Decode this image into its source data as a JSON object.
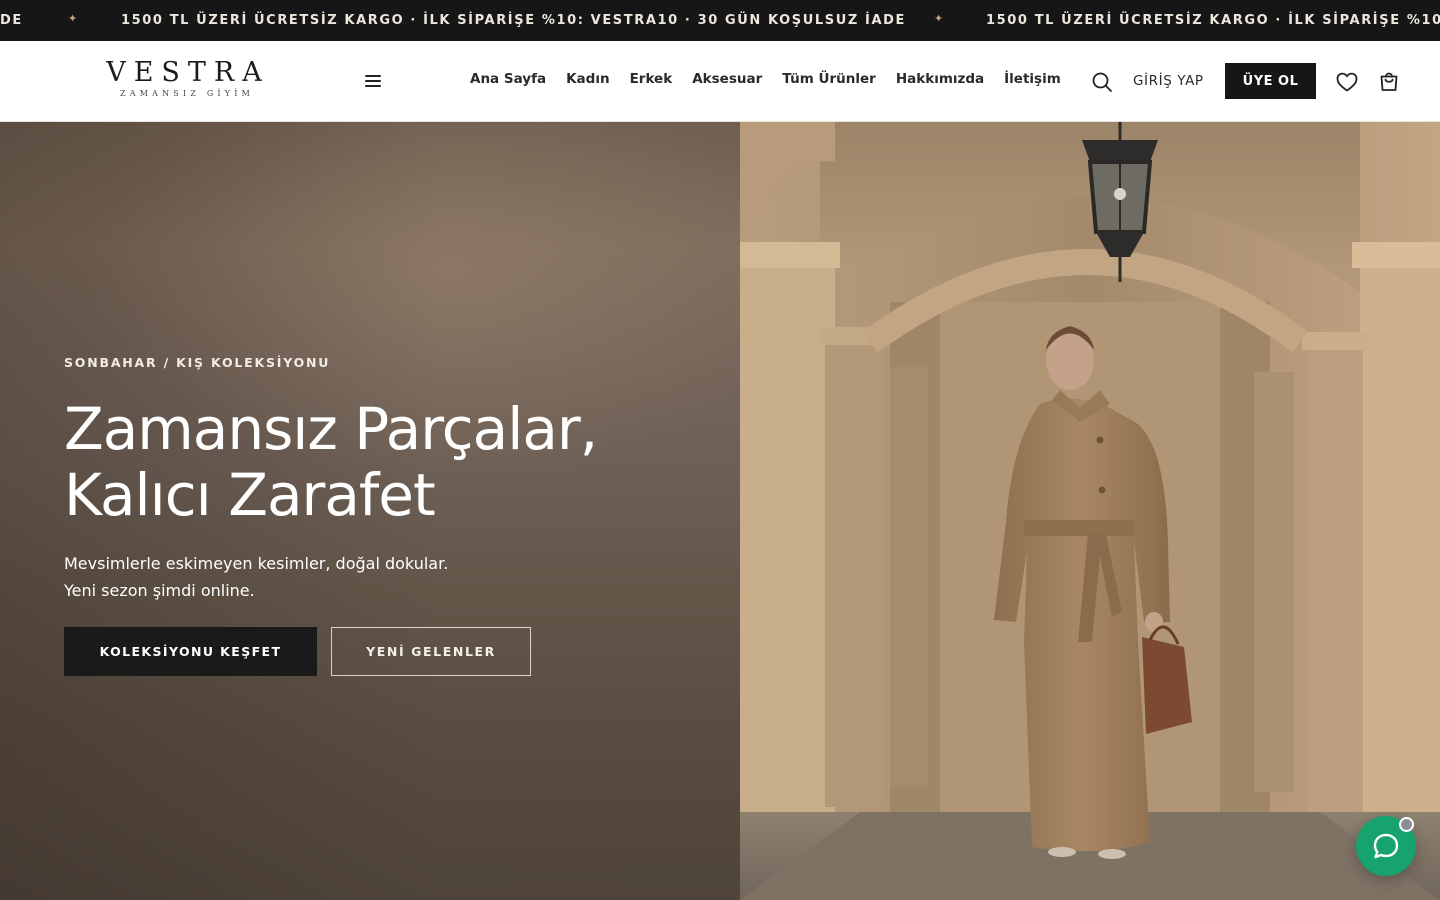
{
  "announcement": {
    "text": "1500 TL ÜZERİ ÜCRETSİZ KARGO · İLK SİPARİŞE %10: VESTRA10 · 30 GÜN KOŞULSUZ İADE",
    "left_fragment": "DE",
    "right_fragment": "1500 TL ÜZERİ ÜCRETSİZ KARGO · İLK SİPARİŞE %10:",
    "separator_icon": "sparkle-icon"
  },
  "header": {
    "logo": {
      "wordmark": "VESTRA",
      "tagline": "ZAMANSIZ GİYİM"
    },
    "menu_icon": "hamburger-icon",
    "nav": [
      {
        "label": "Ana Sayfa"
      },
      {
        "label": "Kadın"
      },
      {
        "label": "Erkek"
      },
      {
        "label": "Aksesuar"
      },
      {
        "label": "Tüm Ürünler"
      },
      {
        "label": "Hakkımızda"
      },
      {
        "label": "İletişim"
      }
    ],
    "search_icon": "search-icon",
    "login_label": "GİRİŞ YAP",
    "signup_label": "ÜYE OL",
    "wishlist_icon": "heart-icon",
    "cart_icon": "shopping-bag-icon"
  },
  "hero": {
    "eyebrow": "SONBAHAR / KIŞ KOLEKSİYONU",
    "headline_line1": "Zamansız Parçalar,",
    "headline_line2": "Kalıcı Zarafet",
    "subtext_line1": "Mevsimlerle eskimeyen kesimler, doğal dokular.",
    "subtext_line2": "Yeni sezon şimdi online.",
    "primary_cta": "KOLEKSİYONU KEŞFET",
    "secondary_cta": "YENİ GELENLER"
  },
  "chat": {
    "icon": "chat-bubble-icon",
    "status_color": "#8a8f95"
  },
  "colors": {
    "accent_dark": "#161616",
    "chat_green": "#16a36e",
    "hero_brown": "#6f5f51",
    "coat_camel": "#a88864"
  }
}
